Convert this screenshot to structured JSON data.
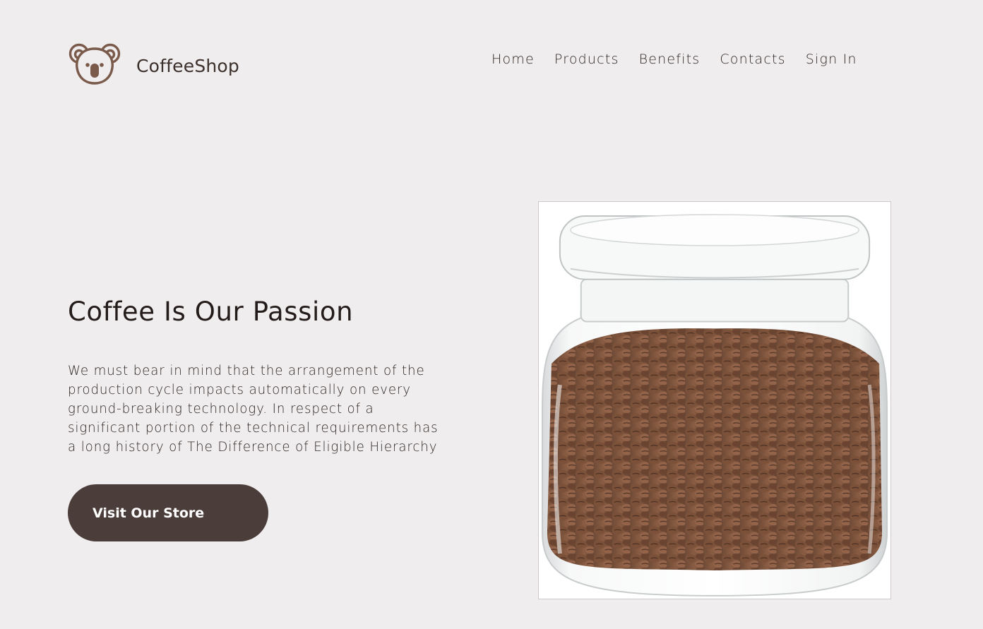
{
  "header": {
    "brand": "CoffeeShop",
    "logo_icon": "koala-icon",
    "nav": [
      {
        "label": "Home"
      },
      {
        "label": "Products"
      },
      {
        "label": "Benefits"
      },
      {
        "label": "Contacts"
      },
      {
        "label": "Sign In"
      }
    ]
  },
  "hero": {
    "title": "Coffee Is Our Passion",
    "description": "We must bear in mind that the arrangement of the production cycle impacts automatically on every ground-breaking technology. In respect of a significant portion of the technical requirements has a long history of The Difference of Eligible Hierarchy",
    "cta_label": "Visit Our Store",
    "image_subject": "glass jar of coffee beans"
  },
  "colors": {
    "background": "#efeded",
    "accent": "#4b3d39",
    "logo": "#7a5a4b",
    "text": "#2b2321"
  }
}
